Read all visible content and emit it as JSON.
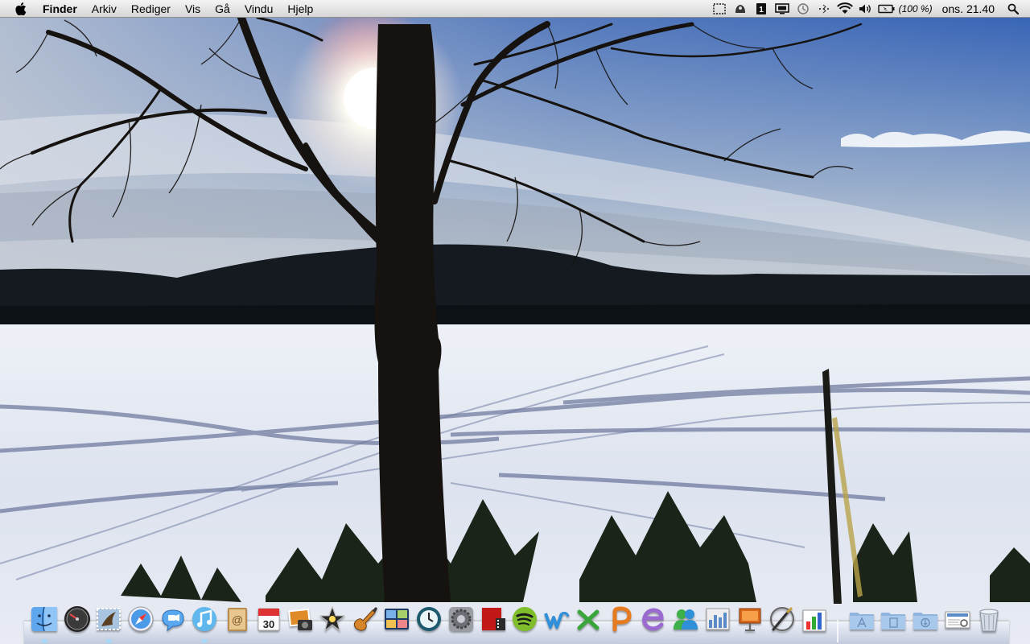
{
  "menubar": {
    "app_name": "Finder",
    "items": [
      "Arkiv",
      "Rediger",
      "Vis",
      "Gå",
      "Vindu",
      "Hjelp"
    ],
    "status_icons": [
      "screen-capture-icon",
      "growl-icon",
      "one-password-icon",
      "display-mirror-icon",
      "time-machine-icon",
      "bluetooth-icon",
      "wifi-icon",
      "volume-icon",
      "battery-icon"
    ],
    "battery_text": "(100 %)",
    "clock": "ons. 21.40",
    "spotlight_icon": "spotlight-search-icon"
  },
  "dock": {
    "apps": [
      {
        "name": "finder",
        "icon": "finder-icon",
        "running": true
      },
      {
        "name": "dashboard",
        "icon": "dashboard-icon",
        "running": false
      },
      {
        "name": "mail",
        "icon": "mail-icon",
        "running": true
      },
      {
        "name": "safari",
        "icon": "safari-icon",
        "running": false
      },
      {
        "name": "ichat",
        "icon": "ichat-icon",
        "running": false
      },
      {
        "name": "itunes",
        "icon": "itunes-icon",
        "running": true
      },
      {
        "name": "address-book",
        "icon": "address-book-icon",
        "running": false
      },
      {
        "name": "ical",
        "icon": "ical-icon",
        "running": false,
        "label": "30"
      },
      {
        "name": "iphoto",
        "icon": "iphoto-icon",
        "running": false
      },
      {
        "name": "imovie",
        "icon": "imovie-icon",
        "running": false
      },
      {
        "name": "garageband",
        "icon": "garageband-icon",
        "running": false
      },
      {
        "name": "spaces",
        "icon": "spaces-icon",
        "running": false
      },
      {
        "name": "time-machine",
        "icon": "time-machine-icon",
        "running": false
      },
      {
        "name": "system-preferences",
        "icon": "system-preferences-icon",
        "running": false
      },
      {
        "name": "flip4mac",
        "icon": "flip4mac-icon",
        "running": false
      },
      {
        "name": "spotify",
        "icon": "spotify-icon",
        "running": false
      },
      {
        "name": "word",
        "icon": "word-icon",
        "running": false
      },
      {
        "name": "excel",
        "icon": "excel-icon",
        "running": false
      },
      {
        "name": "powerpoint",
        "icon": "powerpoint-icon",
        "running": false
      },
      {
        "name": "entourage",
        "icon": "entourage-icon",
        "running": false
      },
      {
        "name": "messenger",
        "icon": "messenger-icon",
        "running": false
      },
      {
        "name": "activity-monitor",
        "icon": "activity-monitor-icon",
        "running": false
      },
      {
        "name": "keynote",
        "icon": "keynote-icon",
        "running": false
      },
      {
        "name": "script-editor",
        "icon": "script-editor-icon",
        "running": false
      },
      {
        "name": "numbers",
        "icon": "numbers-icon",
        "running": false
      }
    ],
    "stacks": [
      {
        "name": "applications",
        "icon": "applications-folder-icon"
      },
      {
        "name": "documents",
        "icon": "documents-folder-icon"
      },
      {
        "name": "downloads",
        "icon": "downloads-folder-icon"
      },
      {
        "name": "preview",
        "icon": "preview-icon"
      },
      {
        "name": "trash",
        "icon": "trash-icon"
      }
    ]
  },
  "colors": {
    "sky_top": "#2f5fb8",
    "sky_horizon": "#c9d3df",
    "snow": "#e4e8f2",
    "hills": "#141a20",
    "shadow": "#5a6690"
  }
}
